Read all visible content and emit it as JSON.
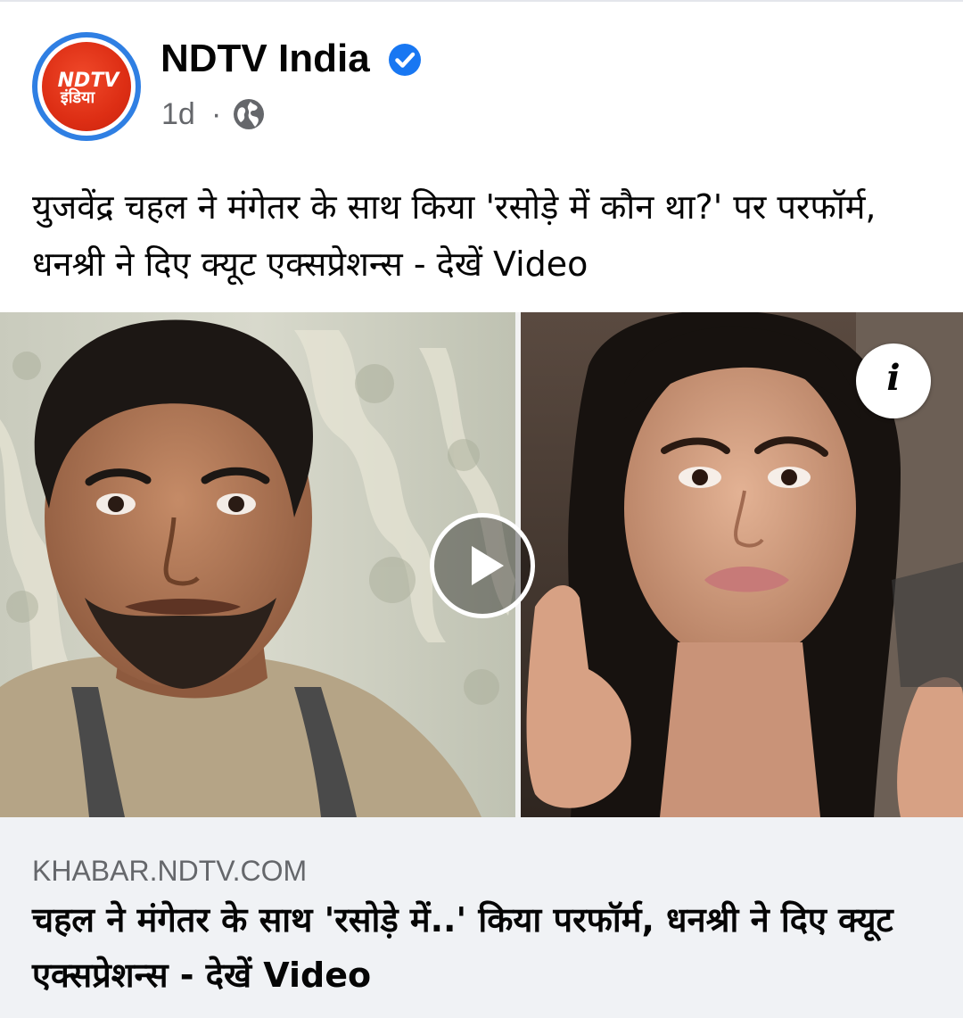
{
  "post": {
    "page_name": "NDTV India",
    "time": "1d",
    "separator": "·",
    "privacy_icon": "globe-icon",
    "verified_icon": "verified-badge-icon",
    "avatar_logo_text": "NDTV इंडिया",
    "caption": "युजवेंद्र चहल ने मंगेतर के साथ किया 'रसोड़े में कौन था?' पर परफॉर्म, धनश्री ने दिए क्यूट एक्सप्रेशन्स - देखें Video"
  },
  "media": {
    "play_icon": "play-icon",
    "info_label": "i"
  },
  "link_preview": {
    "domain": "KHABAR.NDTV.COM",
    "title": "चहल ने मंगेतर के साथ 'रसोड़े में..' किया परफॉर्म, धनश्री ने दिए क्यूट एक्सप्रेशन्स - देखें Video"
  },
  "colors": {
    "page_name": "#050505",
    "meta": "#65676b",
    "verified": "#1877f2",
    "avatar_ring": "#2f7fe3",
    "logo_red": "#dd2e14",
    "preview_bg": "#f0f2f5"
  }
}
